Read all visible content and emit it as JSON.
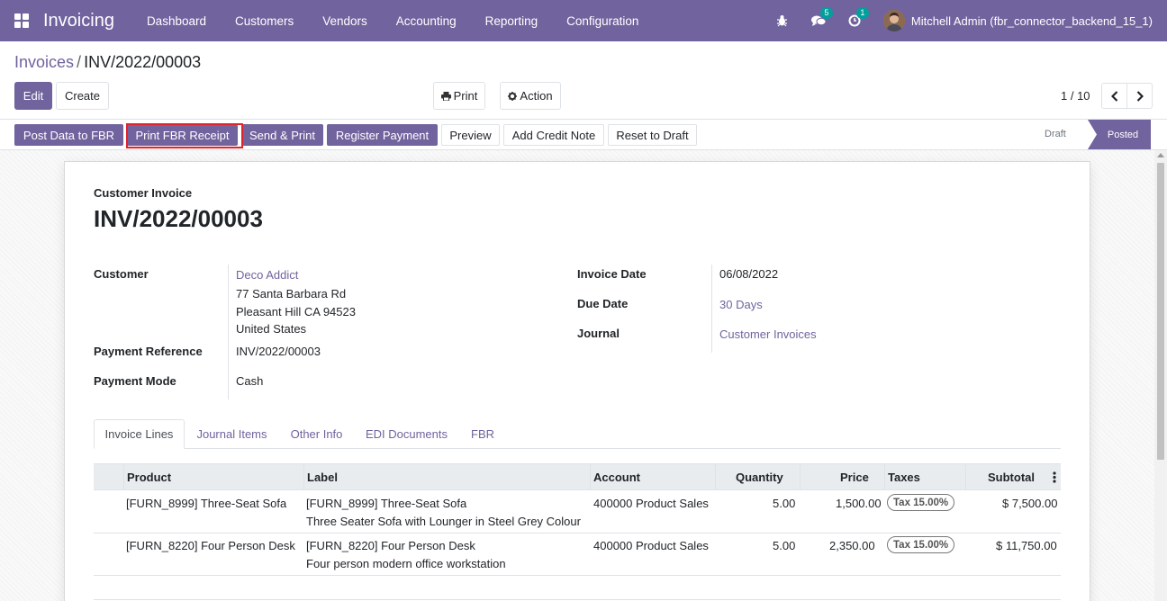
{
  "navbar": {
    "app_title": "Invoicing",
    "menu": [
      "Dashboard",
      "Customers",
      "Vendors",
      "Accounting",
      "Reporting",
      "Configuration"
    ],
    "messages_count": "5",
    "activities_count": "1",
    "user": "Mitchell Admin (fbr_connector_backend_15_1)",
    "accent_color": "#71639e"
  },
  "breadcrumb": {
    "parent": "Invoices",
    "separator": "/",
    "current": "INV/2022/00003"
  },
  "controls": {
    "edit": "Edit",
    "create": "Create",
    "print": "Print",
    "action": "Action",
    "pager": "1 / 10"
  },
  "statusbar": {
    "buttons": [
      "Post Data to FBR",
      "Print FBR Receipt",
      "Send & Print",
      "Register Payment",
      "Preview",
      "Add Credit Note",
      "Reset to Draft"
    ],
    "stages": [
      "Draft",
      "Posted"
    ],
    "active_stage": "Posted"
  },
  "invoice": {
    "type": "Customer Invoice",
    "number": "INV/2022/00003",
    "left_fields": {
      "customer_label": "Customer",
      "customer_name": "Deco Addict",
      "address": [
        "77 Santa Barbara Rd",
        "Pleasant Hill CA 94523",
        "United States"
      ],
      "payment_reference_label": "Payment Reference",
      "payment_reference": "INV/2022/00003",
      "payment_mode_label": "Payment Mode",
      "payment_mode": "Cash"
    },
    "right_fields": {
      "invoice_date_label": "Invoice Date",
      "invoice_date": "06/08/2022",
      "due_date_label": "Due Date",
      "due_date": "30 Days",
      "journal_label": "Journal",
      "journal": "Customer Invoices"
    }
  },
  "tabs": [
    "Invoice Lines",
    "Journal Items",
    "Other Info",
    "EDI Documents",
    "FBR"
  ],
  "table": {
    "columns": [
      "Product",
      "Label",
      "Account",
      "Quantity",
      "Price",
      "Taxes",
      "Subtotal"
    ],
    "rows": [
      {
        "product": "[FURN_8999] Three-Seat Sofa",
        "label": "[FURN_8999] Three-Seat Sofa",
        "label_desc": "Three Seater Sofa with Lounger in Steel Grey Colour",
        "account": "400000 Product Sales",
        "quantity": "5.00",
        "price": "1,500.00",
        "tax": "Tax 15.00%",
        "subtotal": "$ 7,500.00"
      },
      {
        "product": "[FURN_8220] Four Person Desk",
        "label": "[FURN_8220] Four Person Desk",
        "label_desc": "Four person modern office workstation",
        "account": "400000 Product Sales",
        "quantity": "5.00",
        "price": "2,350.00",
        "tax": "Tax 15.00%",
        "subtotal": "$ 11,750.00"
      }
    ]
  }
}
